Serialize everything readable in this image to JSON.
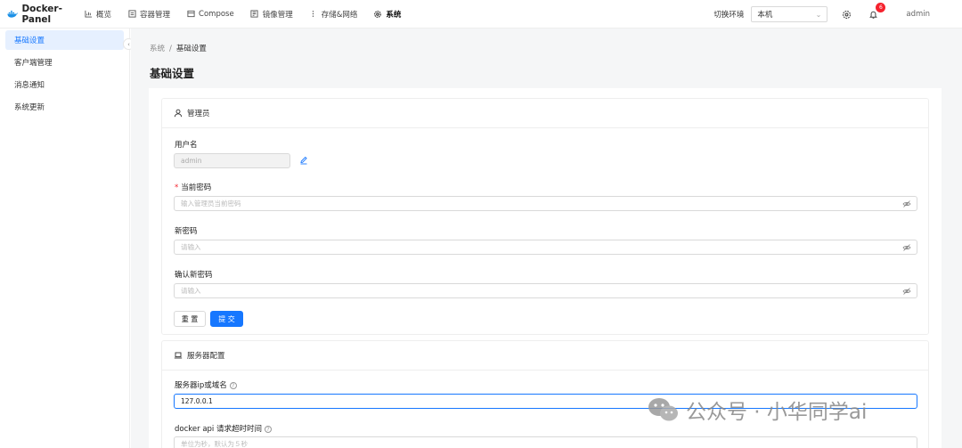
{
  "app": {
    "name": "Docker-Panel"
  },
  "nav": [
    {
      "label": "概览",
      "icon": "chart-icon"
    },
    {
      "label": "容器管理",
      "icon": "container-icon"
    },
    {
      "label": "Compose",
      "icon": "compose-icon"
    },
    {
      "label": "镜像管理",
      "icon": "image-icon"
    },
    {
      "label": "存储&网络",
      "icon": "storage-icon"
    },
    {
      "label": "系统",
      "icon": "gear-icon",
      "active": true
    }
  ],
  "header": {
    "env_label": "切换环境",
    "env_value": "本机",
    "notification_count": "6",
    "user": "admin"
  },
  "sidebar": {
    "items": [
      {
        "label": "基础设置",
        "active": true
      },
      {
        "label": "客户端管理"
      },
      {
        "label": "消息通知"
      },
      {
        "label": "系统更新"
      }
    ]
  },
  "breadcrumb": {
    "root": "系统",
    "separator": "/",
    "current": "基础设置"
  },
  "page_title": "基础设置",
  "admin_card": {
    "title": "管理员",
    "username_label": "用户名",
    "username_value": "admin",
    "current_password_label": "当前密码",
    "current_password_placeholder": "输入管理员当前密码",
    "new_password_label": "新密码",
    "new_password_placeholder": "请输入",
    "confirm_password_label": "确认新密码",
    "confirm_password_placeholder": "请输入",
    "reset_label": "重 置",
    "submit_label": "提 交"
  },
  "server_card": {
    "title": "服务器配置",
    "host_label": "服务器ip或域名",
    "host_value": "127.0.0.1",
    "timeout_label": "docker api 请求超时时间",
    "timeout_placeholder": "单位为秒，默认为５秒"
  },
  "watermark": {
    "text": "公众号 · 小华同学ai"
  },
  "colors": {
    "primary": "#1677ff",
    "badge": "#f5222d",
    "content_bg": "#f5f6f7"
  }
}
